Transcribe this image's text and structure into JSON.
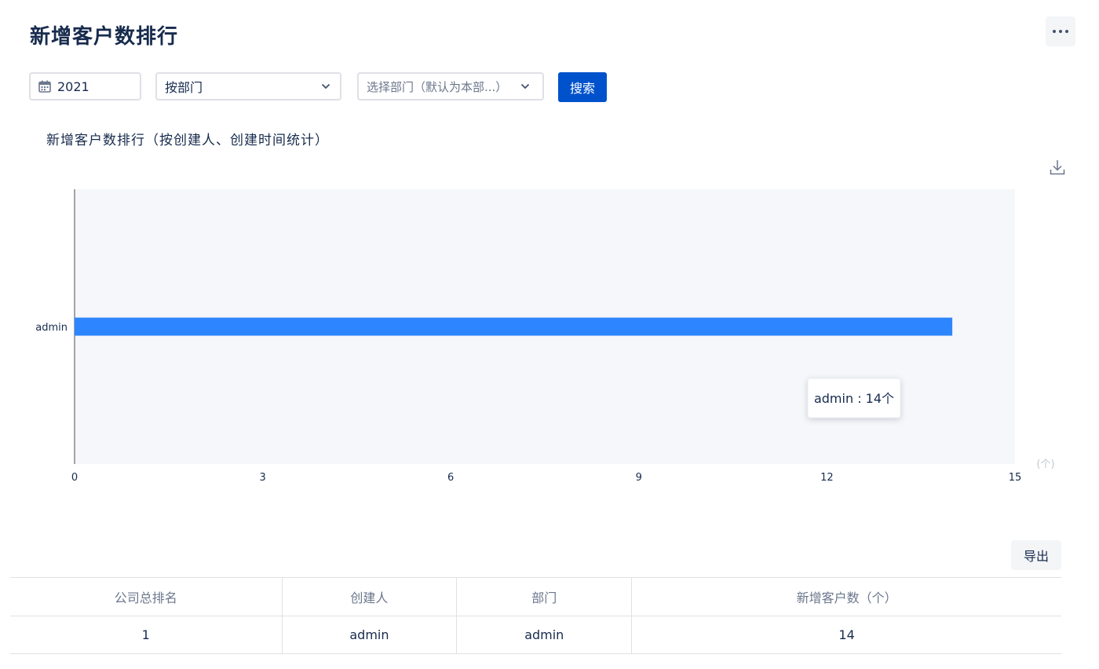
{
  "page": {
    "title": "新增客户数排行"
  },
  "filters": {
    "year": "2021",
    "group_by": "按部门",
    "dept_placeholder": "选择部门（默认为本部...）",
    "search_label": "搜索"
  },
  "chart_data": {
    "type": "bar",
    "orientation": "horizontal",
    "title": "新增客户数排行（按创建人、创建时间统计）",
    "categories": [
      "admin"
    ],
    "values": [
      14
    ],
    "xlim": [
      0,
      15
    ],
    "xticks": [
      0,
      3,
      6,
      9,
      12,
      15
    ],
    "xlabel": "(个)",
    "bar_color": "#2d86ff",
    "plot_background": "#f6f7fa",
    "tooltip": "admin : 14个"
  },
  "table": {
    "export_label": "导出",
    "columns": [
      "公司总排名",
      "创建人",
      "部门",
      "新增客户数（个）"
    ],
    "rows": [
      [
        "1",
        "admin",
        "admin",
        "14"
      ]
    ]
  }
}
